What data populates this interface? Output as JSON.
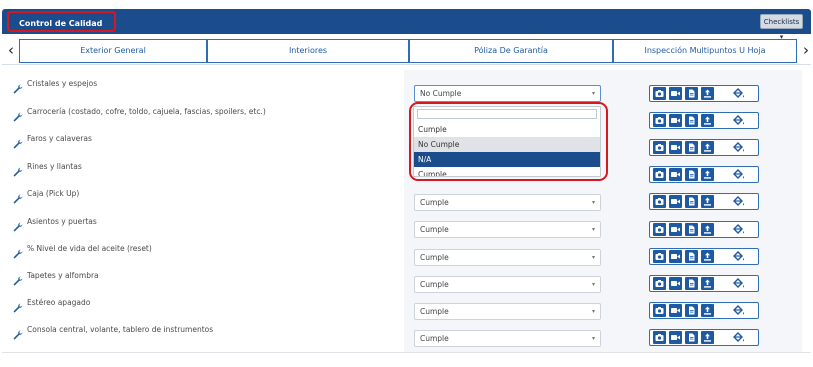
{
  "header": {
    "title": "Control de Calidad",
    "checklists_label": "Checklists ▾"
  },
  "tabs": {
    "prev": "‹",
    "next": "›",
    "items": [
      {
        "label": "Exterior General"
      },
      {
        "label": "Interiores"
      },
      {
        "label": "Póliza De Garantía"
      },
      {
        "label": "Inspección Multipuntos U Hoja"
      }
    ]
  },
  "items": [
    {
      "label": "Cristales y espejos",
      "value": "No Cumple"
    },
    {
      "label": "Carrocería (costado, cofre, toldo, cajuela, fascias, spoilers, etc.)",
      "value": ""
    },
    {
      "label": "Faros y calaveras",
      "value": ""
    },
    {
      "label": "Rines y llantas",
      "value": ""
    },
    {
      "label": "Caja (Pick Up)",
      "value": "Cumple"
    },
    {
      "label": "Asientos y puertas",
      "value": "Cumple"
    },
    {
      "label": "% Nivel de vida del aceite (reset)",
      "value": "Cumple"
    },
    {
      "label": "Tapetes y alfombra",
      "value": "Cumple"
    },
    {
      "label": "Estéreo apagado",
      "value": "Cumple"
    },
    {
      "label": "Consola central, volante, tablero de instrumentos",
      "value": "Cumple"
    }
  ],
  "dropdown": {
    "options": [
      "Cumple",
      "No Cumple",
      "N/A",
      "Cumple"
    ]
  },
  "caret": "▾",
  "colors": {
    "primary": "#1b4d8c",
    "highlight": "#d61820",
    "accent": "#1e5aa3"
  }
}
